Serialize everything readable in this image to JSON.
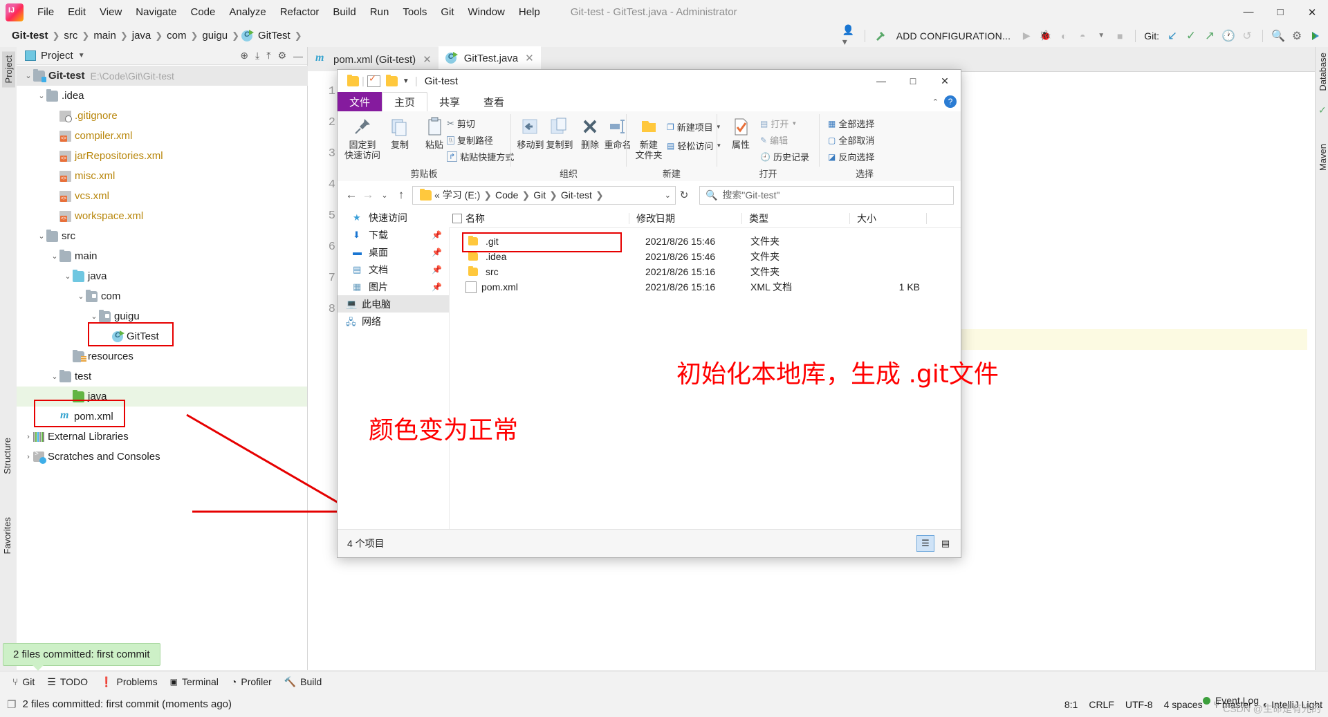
{
  "ide": {
    "window_title": "Git-test - GitTest.java - Administrator",
    "menu": [
      "File",
      "Edit",
      "View",
      "Navigate",
      "Code",
      "Analyze",
      "Refactor",
      "Build",
      "Run",
      "Tools",
      "Git",
      "Window",
      "Help"
    ],
    "window_controls": [
      "—",
      "□",
      "✕"
    ],
    "breadcrumbs": [
      "Git-test",
      "src",
      "main",
      "java",
      "com",
      "guigu",
      "GitTest"
    ],
    "toolbar": {
      "add_configuration": "ADD CONFIGURATION...",
      "git_label": "Git:"
    },
    "project_panel": {
      "title": "Project",
      "root_label": "Git-test",
      "root_path": "E:\\Code\\Git\\Git-test",
      "tree": [
        {
          "label": ".idea",
          "indent": 1,
          "icon": "folder-icon",
          "arrow": "v",
          "color": "normal"
        },
        {
          "label": ".gitignore",
          "indent": 2,
          "icon": "gitignore-icon",
          "arrow": "",
          "color": "modified"
        },
        {
          "label": "compiler.xml",
          "indent": 2,
          "icon": "xml-file-icon",
          "arrow": "",
          "color": "modified"
        },
        {
          "label": "jarRepositories.xml",
          "indent": 2,
          "icon": "xml-file-icon",
          "arrow": "",
          "color": "modified"
        },
        {
          "label": "misc.xml",
          "indent": 2,
          "icon": "xml-file-icon",
          "arrow": "",
          "color": "modified"
        },
        {
          "label": "vcs.xml",
          "indent": 2,
          "icon": "xml-file-icon",
          "arrow": "",
          "color": "modified"
        },
        {
          "label": "workspace.xml",
          "indent": 2,
          "icon": "xml-file-icon",
          "arrow": "",
          "color": "modified"
        },
        {
          "label": "src",
          "indent": 1,
          "icon": "folder-icon",
          "arrow": "v",
          "color": "normal"
        },
        {
          "label": "main",
          "indent": 2,
          "icon": "folder-icon",
          "arrow": "v",
          "color": "normal"
        },
        {
          "label": "java",
          "indent": 3,
          "icon": "source-folder-icon",
          "arrow": "v",
          "color": "normal"
        },
        {
          "label": "com",
          "indent": 4,
          "icon": "package-icon",
          "arrow": "v",
          "color": "normal"
        },
        {
          "label": "guigu",
          "indent": 5,
          "icon": "package-icon",
          "arrow": "v",
          "color": "normal"
        },
        {
          "label": "GitTest",
          "indent": 6,
          "icon": "java-class-icon",
          "arrow": "",
          "color": "normal"
        },
        {
          "label": "resources",
          "indent": 3,
          "icon": "resources-folder-icon",
          "arrow": "",
          "color": "normal"
        },
        {
          "label": "test",
          "indent": 2,
          "icon": "folder-icon",
          "arrow": "v",
          "color": "normal"
        },
        {
          "label": "java",
          "indent": 3,
          "icon": "test-source-folder-icon",
          "arrow": "",
          "color": "normal"
        },
        {
          "label": "pom.xml",
          "indent": 2,
          "icon": "maven-icon",
          "arrow": "",
          "color": "normal"
        },
        {
          "label": "External Libraries",
          "indent": 0,
          "icon": "libraries-icon",
          "arrow": ">",
          "color": "normal"
        },
        {
          "label": "Scratches and Consoles",
          "indent": 0,
          "icon": "scratches-icon",
          "arrow": ">",
          "color": "normal"
        }
      ]
    },
    "editor": {
      "tabs": [
        {
          "label": "pom.xml (Git-test)",
          "icon": "maven-icon",
          "active": false
        },
        {
          "label": "GitTest.java",
          "icon": "java-class-icon",
          "active": true
        }
      ],
      "line_numbers": [
        "1",
        "2",
        "3",
        "4",
        "5",
        "6",
        "7",
        "8"
      ]
    },
    "right_stripe": [
      "Database",
      "Maven"
    ],
    "left_stripe": [
      "Project",
      "Structure",
      "Favorites"
    ],
    "bottom_windows": [
      {
        "label": "Git",
        "icon": "git-branch-icon"
      },
      {
        "label": "TODO",
        "icon": "list-icon"
      },
      {
        "label": "Problems",
        "icon": "warning-icon"
      },
      {
        "label": "Terminal",
        "icon": "terminal-icon"
      },
      {
        "label": "Profiler",
        "icon": "profiler-icon"
      },
      {
        "label": "Build",
        "icon": "hammer-icon"
      }
    ],
    "balloon_text": "2 files committed: first commit",
    "status_message": "2 files committed: first commit (moments ago)",
    "status_right": [
      "8:1",
      "CRLF",
      "UTF-8",
      "4 spaces",
      "master",
      "IntelliJ Light"
    ],
    "event_log": "Event Log"
  },
  "explorer": {
    "title": "Git-test",
    "window_controls": [
      "—",
      "□",
      "✕"
    ],
    "ribbon_tabs": [
      "文件",
      "主页",
      "共享",
      "查看"
    ],
    "ribbon_groups": [
      {
        "name": "剪贴板",
        "big_buttons": [
          {
            "label_1": "固定到",
            "label_2": "快速访问",
            "icon": "pin-icon"
          },
          {
            "label_1": "复制",
            "label_2": "",
            "icon": "copy-icon"
          },
          {
            "label_1": "粘贴",
            "label_2": "",
            "icon": "paste-icon"
          }
        ],
        "small_buttons": [
          "剪切",
          "复制路径",
          "粘贴快捷方式"
        ]
      },
      {
        "name": "组织",
        "big_buttons": [
          {
            "label_1": "移动到",
            "label_2": "",
            "icon": "move-to-icon"
          },
          {
            "label_1": "复制到",
            "label_2": "",
            "icon": "copy-to-icon"
          },
          {
            "label_1": "删除",
            "label_2": "",
            "icon": "delete-icon"
          },
          {
            "label_1": "重命名",
            "label_2": "",
            "icon": "rename-icon"
          }
        ],
        "small_buttons": []
      },
      {
        "name": "新建",
        "big_buttons": [
          {
            "label_1": "新建",
            "label_2": "文件夹",
            "icon": "new-folder-icon"
          }
        ],
        "small_buttons": [
          "新建项目",
          "轻松访问"
        ]
      },
      {
        "name": "打开",
        "big_buttons": [
          {
            "label_1": "属性",
            "label_2": "",
            "icon": "properties-icon"
          }
        ],
        "small_buttons": [
          "打开",
          "编辑",
          "历史记录"
        ]
      },
      {
        "name": "选择",
        "big_buttons": [],
        "small_buttons": [
          "全部选择",
          "全部取消",
          "反向选择"
        ]
      }
    ],
    "address": {
      "path_parts": [
        "学习 (E:)",
        "Code",
        "Git",
        "Git-test"
      ],
      "search_placeholder": "搜索\"Git-test\""
    },
    "nav_pane": [
      {
        "label": "快速访问",
        "icon": "star-icon",
        "pinned": false,
        "selected": false
      },
      {
        "label": "下载",
        "icon": "download-icon",
        "pinned": true,
        "selected": false
      },
      {
        "label": "桌面",
        "icon": "desktop-icon",
        "pinned": true,
        "selected": false
      },
      {
        "label": "文档",
        "icon": "documents-icon",
        "pinned": true,
        "selected": false
      },
      {
        "label": "图片",
        "icon": "pictures-icon",
        "pinned": true,
        "selected": false
      },
      {
        "label": "此电脑",
        "icon": "this-pc-icon",
        "pinned": false,
        "selected": true
      },
      {
        "label": "网络",
        "icon": "network-icon",
        "pinned": false,
        "selected": false
      }
    ],
    "columns": [
      "名称",
      "修改日期",
      "类型",
      "大小"
    ],
    "files": [
      {
        "name": ".git",
        "date": "2021/8/26 15:46",
        "type": "文件夹",
        "size": "",
        "icon": "folder-icon"
      },
      {
        "name": ".idea",
        "date": "2021/8/26 15:46",
        "type": "文件夹",
        "size": "",
        "icon": "folder-icon"
      },
      {
        "name": "src",
        "date": "2021/8/26 15:16",
        "type": "文件夹",
        "size": "",
        "icon": "folder-icon"
      },
      {
        "name": "pom.xml",
        "date": "2021/8/26 15:16",
        "type": "XML 文档",
        "size": "1 KB",
        "icon": "file-icon"
      }
    ],
    "status": "4 个项目"
  },
  "annotations": {
    "note_right": "初始化本地库，生成 .git文件",
    "note_left": "颜色变为正常",
    "highlight_color": "#e60000"
  },
  "watermark": "CSDN @生命是有光的"
}
